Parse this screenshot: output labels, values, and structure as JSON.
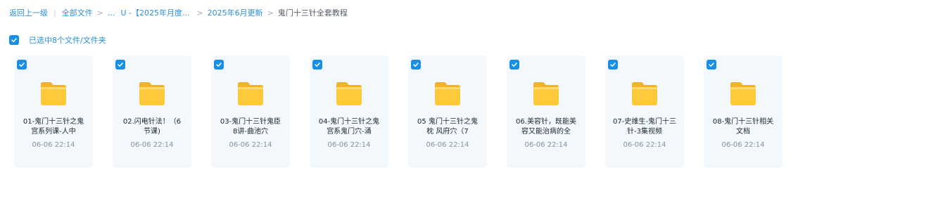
{
  "breadcrumb": {
    "back": "返回上一级",
    "all_files": "全部文件",
    "ellipsis": "...",
    "crumb_u": "U -【2025年月度...",
    "crumb_month": "2025年6月更新",
    "current": "鬼门十三针全套教程"
  },
  "selection": {
    "text": "已选中8个文件/文件夹"
  },
  "colors": {
    "accent": "#1a8fe6",
    "card_bg": "#f2f8fc",
    "folder": "#ffc83d"
  },
  "files": [
    {
      "name": "01-鬼门十三针之鬼宫系列课-人中",
      "date": "06-06 22:14",
      "icon": "folder-icon",
      "checked": true
    },
    {
      "name": "02.闪电针法！（6节课)",
      "date": "06-06 22:14",
      "icon": "folder-icon",
      "checked": true
    },
    {
      "name": "03-鬼门十三针鬼臣8讲-曲池穴",
      "date": "06-06 22:14",
      "icon": "folder-icon",
      "checked": true
    },
    {
      "name": "04-鬼门十三针之鬼宫系鬼门穴-涌",
      "date": "06-06 22:14",
      "icon": "folder-icon",
      "checked": true
    },
    {
      "name": "05 鬼门十三针之鬼枕 风府穴（7",
      "date": "06-06 22:14",
      "icon": "folder-icon",
      "checked": true
    },
    {
      "name": "06.美容针，既能美容又能治病的全",
      "date": "06-06 22:14",
      "icon": "folder-icon",
      "checked": true
    },
    {
      "name": "07-史维生-鬼门十三针-3集视频",
      "date": "06-06 22:14",
      "icon": "folder-icon",
      "checked": true
    },
    {
      "name": "08-鬼门十三针相关文档",
      "date": "06-06 22:14",
      "icon": "folder-icon",
      "checked": true
    }
  ]
}
